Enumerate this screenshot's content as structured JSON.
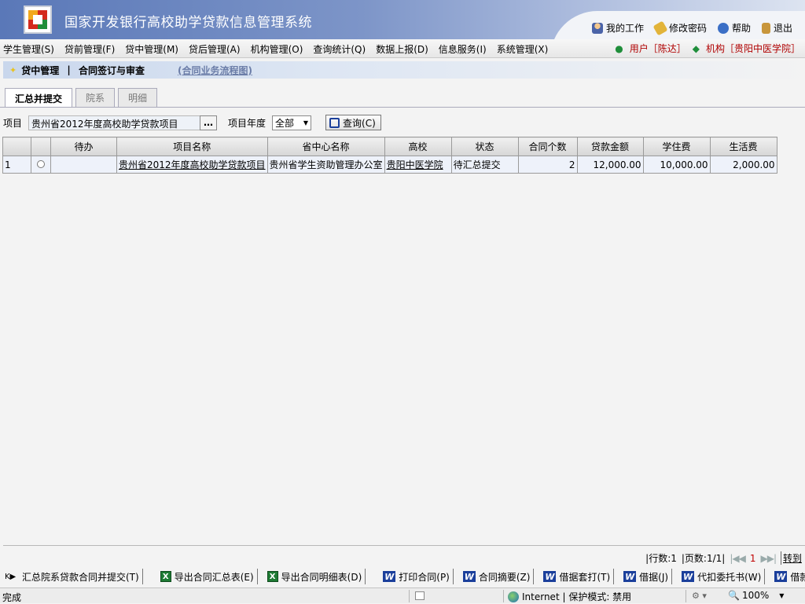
{
  "header": {
    "title": "国家开发银行高校助学贷款信息管理系统",
    "links": [
      {
        "label": "我的工作",
        "icon": "user-icon"
      },
      {
        "label": "修改密码",
        "icon": "key-icon"
      },
      {
        "label": "帮助",
        "icon": "help-icon"
      },
      {
        "label": "退出",
        "icon": "exit-icon"
      }
    ]
  },
  "menu": {
    "items": [
      "学生管理(S)",
      "贷前管理(F)",
      "贷中管理(M)",
      "贷后管理(A)",
      "机构管理(O)",
      "查询统计(Q)",
      "数据上报(D)",
      "信息服务(I)",
      "系统管理(X)"
    ],
    "user": "用户［陈达］",
    "org": "机构［贵阳中医学院］"
  },
  "breadcrumb": {
    "section": "贷中管理",
    "page": "合同签订与审查",
    "flow_link": "(合同业务流程图)"
  },
  "tabs": [
    "汇总并提交",
    "院系",
    "明细"
  ],
  "filter": {
    "project_label": "项目",
    "project_value": "贵州省2012年度高校助学贷款项目",
    "ellipsis": "…",
    "year_label": "项目年度",
    "year_value": "全部",
    "query_label": "查询(C)"
  },
  "table": {
    "headers": [
      "",
      "",
      "待办",
      "项目名称",
      "省中心名称",
      "高校",
      "状态",
      "合同个数",
      "贷款金额",
      "学住费",
      "生活费"
    ],
    "rows": [
      {
        "index": "1",
        "todo": "",
        "project": "贵州省2012年度高校助学贷款项目",
        "center": "贵州省学生资助管理办公室",
        "school": "贵阳中医学院",
        "status": "待汇总提交",
        "count": "2",
        "amount": "12,000.00",
        "tuition": "10,000.00",
        "living": "2,000.00"
      }
    ]
  },
  "pager": {
    "rows": "|行数:1",
    "pages": "|页数:1/1|",
    "current": "1",
    "goto": "转到"
  },
  "actions": [
    {
      "label": "汇总院系贷款合同并提交(T)",
      "icon": "submit-icon"
    },
    {
      "label": "导出合同汇总表(E)",
      "icon": "excel-icon"
    },
    {
      "label": "导出合同明细表(D)",
      "icon": "excel-icon"
    },
    {
      "label": "打印合同(P)",
      "icon": "word-icon"
    },
    {
      "label": "合同摘要(Z)",
      "icon": "word-icon"
    },
    {
      "label": "借据套打(T)",
      "icon": "word-icon"
    },
    {
      "label": "借据(J)",
      "icon": "word-icon"
    },
    {
      "label": "代扣委托书(W)",
      "icon": "word-icon"
    },
    {
      "label": "借款学",
      "icon": "word-icon"
    }
  ],
  "statusbar": {
    "text": "完成",
    "zone": "Internet | 保护模式: 禁用",
    "zoom": "100%"
  }
}
